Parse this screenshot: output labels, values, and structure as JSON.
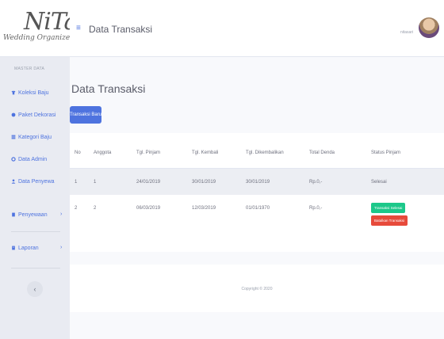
{
  "brand": {
    "name": "NiTa",
    "subtitle": "Wedding Organizer"
  },
  "sidebar": {
    "heading": "MASTER DATA",
    "items": [
      {
        "label": "Koleksi Baju",
        "icon": "shirt-icon",
        "has_chevron": false
      },
      {
        "label": "Paket Dekorasi",
        "icon": "circle-icon",
        "has_chevron": false
      },
      {
        "label": "Kategori Baju",
        "icon": "list-icon",
        "has_chevron": false
      },
      {
        "label": "Data Admin",
        "icon": "gear-icon",
        "has_chevron": false
      },
      {
        "label": "Data Penyewa",
        "icon": "user-icon",
        "has_chevron": false
      },
      {
        "label": "Penyewaan",
        "icon": "book-icon",
        "has_chevron": true
      },
      {
        "label": "Laporan",
        "icon": "report-icon",
        "has_chevron": true
      }
    ],
    "toggle_glyph": "‹"
  },
  "topbar": {
    "menu_glyph": "≡",
    "title": "Data Transaksi",
    "user_name": "nitasari"
  },
  "main": {
    "title": "Data Transaksi",
    "new_button": "Transaksi Baru",
    "table": {
      "headers": [
        "No",
        "Anggota",
        "Tgl. Pinjam",
        "Tgl. Kembali",
        "Tgl. Dikembalikan",
        "Total Denda",
        "Status Pinjam"
      ],
      "rows": [
        {
          "no": "1",
          "anggota": "1",
          "pinjam": "24/01/2019",
          "kembali": "30/01/2019",
          "dikembalikan": "30/01/2019",
          "denda": "Rp.0,-",
          "status": "Selesai"
        },
        {
          "no": "2",
          "anggota": "2",
          "pinjam": "06/03/2019",
          "kembali": "12/03/2019",
          "dikembalikan": "01/01/1970",
          "denda": "Rp.0,-",
          "action_done": "Transaksi Selesai",
          "action_cancel": "Batalkan Transaksi"
        }
      ]
    }
  },
  "footer": {
    "copyright": "Copyright © 2020"
  },
  "colors": {
    "primary": "#4e73df",
    "success": "#1cc88a",
    "danger": "#e74a3b"
  }
}
